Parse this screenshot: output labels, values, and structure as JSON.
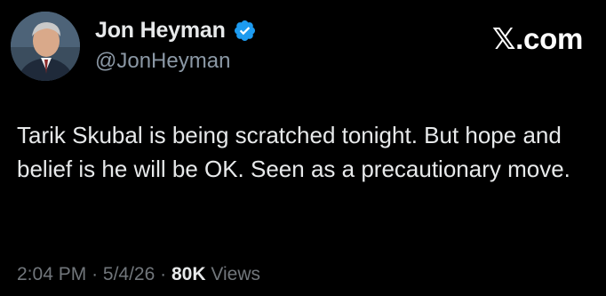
{
  "author": {
    "name": "Jon Heyman",
    "handle": "@JonHeyman",
    "verified": true
  },
  "brand": "𝕏.com",
  "tweet": {
    "text": "Tarik Skubal is being scratched tonight. But hope and belief is he will be OK. Seen as a precautionary move.",
    "time": "2:04 PM",
    "date": "5/4/26",
    "separator": "·",
    "views_count": "80K",
    "views_label": "Views"
  },
  "colors": {
    "background": "#000000",
    "text_primary": "#e7e9ea",
    "text_secondary": "#71767b",
    "verified_blue": "#1d9bf0"
  }
}
